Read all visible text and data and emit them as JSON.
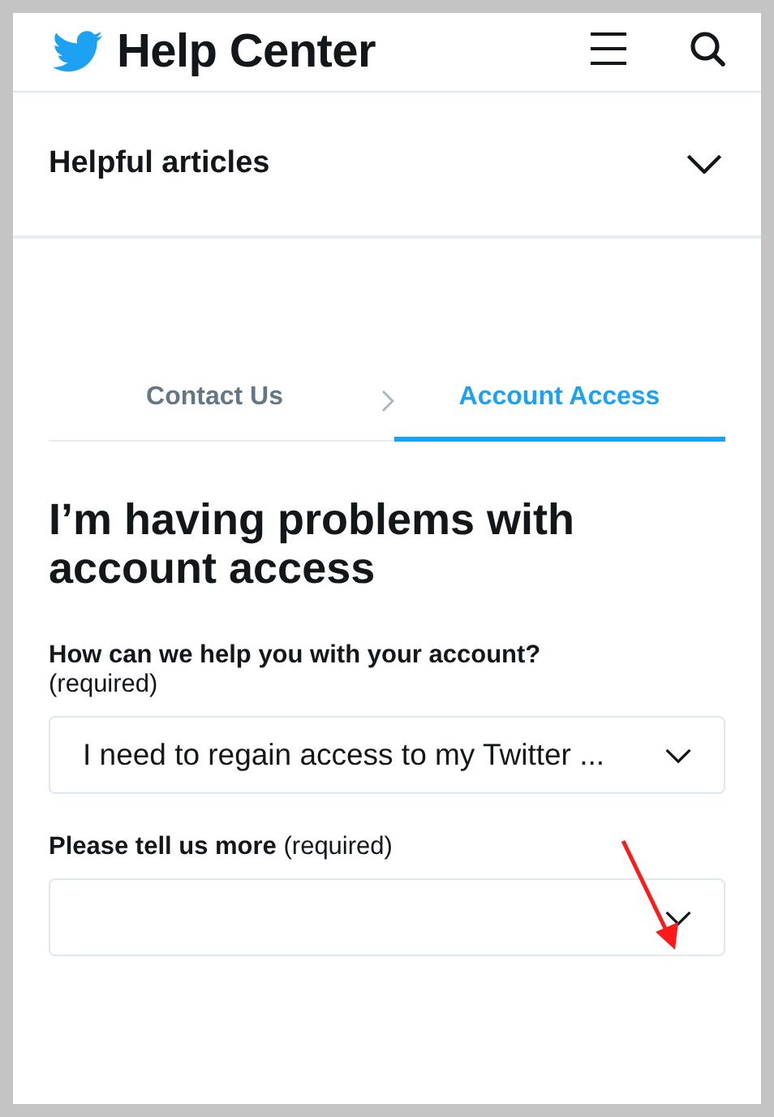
{
  "header": {
    "title": "Help Center"
  },
  "accordion": {
    "label": "Helpful articles",
    "expanded": false
  },
  "tabs": [
    {
      "label": "Contact Us",
      "selected": false
    },
    {
      "label": "Account Access",
      "selected": true
    }
  ],
  "heading": "I’m having problems with account access",
  "fields": [
    {
      "kind": "select",
      "label": "How can we help you with your account?",
      "note": "(required)",
      "value": "I need to regain access to my Twitter ..."
    },
    {
      "kind": "select",
      "label": "**Please tell us more** (required)"
    }
  ]
}
